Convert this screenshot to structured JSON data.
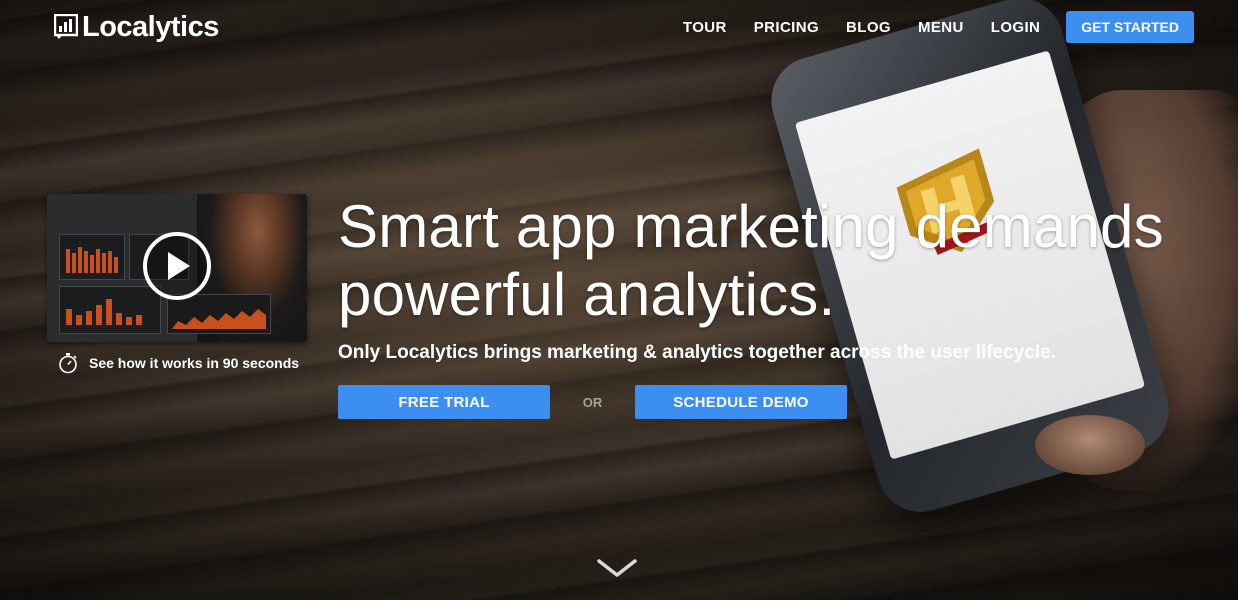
{
  "brand": {
    "name": "Localytics"
  },
  "nav": {
    "items": [
      {
        "label": "TOUR"
      },
      {
        "label": "PRICING"
      },
      {
        "label": "BLOG"
      },
      {
        "label": "MENU"
      },
      {
        "label": "LOGIN"
      }
    ],
    "cta_label": "GET STARTED"
  },
  "video": {
    "caption": "See how it works in 90 seconds"
  },
  "hero": {
    "headline_line1": "Smart app marketing demands",
    "headline_line2": "powerful analytics.",
    "subheadline": "Only Localytics brings marketing & analytics together across the user lifecycle.",
    "primary_cta": "FREE TRIAL",
    "separator": "OR",
    "secondary_cta": "SCHEDULE DEMO"
  },
  "colors": {
    "accent": "#3c8ff0",
    "chart_bar": "#c8501e",
    "text": "#ffffff"
  },
  "icons": {
    "logo": "bar-chart-icon",
    "play": "play-icon",
    "timer": "stopwatch-icon",
    "scroll": "chevron-down-icon"
  }
}
